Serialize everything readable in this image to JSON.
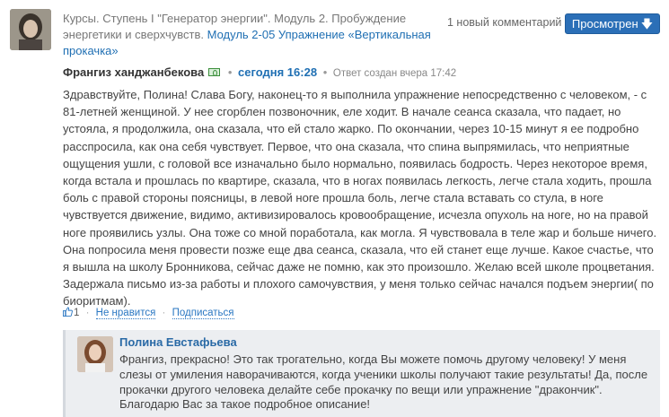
{
  "post": {
    "course_text": "Курсы. Ступень I \"Генератор энергии\". Модуль 2. Пробуждение энергетики и сверхчувств.",
    "module_link": "Модуль 2-05 Упражнение «Вертикальная прокачка»",
    "new_comments": "1 новый комментарий",
    "view_button": "Просмотрен",
    "view_arrow": "🡇"
  },
  "comment": {
    "author": "Франгиз ханджанбекова",
    "separator": "•",
    "time": "сегодня 16:28",
    "created_note": "Ответ создан вчера 17:42",
    "body": "Здравствуйте, Полина! Слава Богу, наконец-то я выполнила упражнение непосредственно с человеком, - с 81-летней женщиной. У нее сгорблен позвоночник, еле ходит. В начале сеанса сказала, что падает, но устояла, я продолжила, она сказала, что ей стало жарко. По окончании, через 10-15 минут я ее подробно расспросила, как она себя чувствует. Первое, что она сказала, что спина выпрямилась, что неприятные ощущения ушли, с головой все изначально было нормально, появилась бодрость. Через некоторое время, когда встала и прошлась по квартире, сказала, что в ногах появилась легкость, легче стала ходить, прошла боль с правой стороны поясницы, в левой ноге прошла боль, легче стала вставать со стула, в ноге чувствуется движение, видимо, активизировалось кровообращение, исчезла опухоль на ноге, но на правой ноге проявились узлы. Она тоже со мной поработала, как могла. Я чувствовала в теле жар и больше ничего. Она попросила меня провести позже еще два сеанса, сказала, что ей станет еще лучше. Какое счастье, что я вышла на школу Бронникова, сейчас даже не помню, как это произошло. Желаю всей школе процветания. Задержала письмо из-за работы и плохого самочувствия, у меня только сейчас начался подъем энергии( по биоритмам).",
    "likes": "1",
    "dislike_label": "Не нравится",
    "subscribe_label": "Подписаться",
    "dot": "·"
  },
  "reply": {
    "author": "Полина Евстафьева",
    "body": "Франгиз, прекрасно! Это так трогательно, когда Вы можете помочь другому человеку! У меня слезы от умиления наворачиваются, когда ученики школы получают такие результаты! Да, после прокачки другого человека делайте себе прокачку по вещи или упражнение \"дракончик\". Благодарю Вас за такое подробное описание!"
  },
  "colors": {
    "link": "#1f6fb3",
    "button_bg": "#2b6fb7",
    "reply_bg": "#eceef1"
  }
}
